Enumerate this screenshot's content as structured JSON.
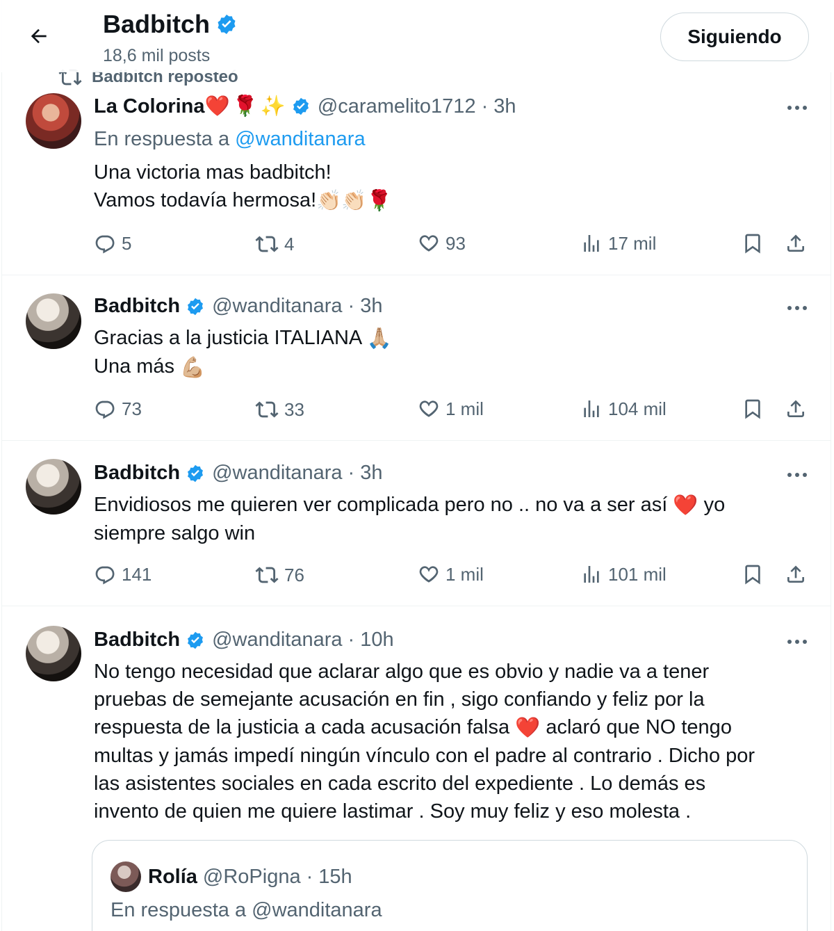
{
  "header": {
    "title": "Badbitch",
    "posts_count": "18,6 mil posts",
    "follow_button": "Siguiendo"
  },
  "repost_banner": "Badbitch reposteó",
  "tweets": [
    {
      "name": "La Colorina",
      "name_emojis": [
        "❤️",
        "🌹",
        "✨"
      ],
      "verified": true,
      "handle": "@caramelito1712",
      "time": "3h",
      "reply_prefix": "En respuesta a",
      "reply_to": "@wanditanara",
      "lines": [
        "Una victoria mas badbitch!",
        "Vamos todavía hermosa!"
      ],
      "line2_emojis": "👏🏻👏🏻🌹",
      "replies": "5",
      "reposts": "4",
      "likes": "93",
      "views": "17 mil"
    },
    {
      "name": "Badbitch",
      "verified": true,
      "handle": "@wanditanara",
      "time": "3h",
      "lines": [
        "Gracias a la justicia ITALIANA",
        "Una más"
      ],
      "line1_emoji": "🙏🏼",
      "line2_emoji": "💪🏼",
      "replies": "73",
      "reposts": "33",
      "likes": "1 mil",
      "views": "104 mil"
    },
    {
      "name": "Badbitch",
      "verified": true,
      "handle": "@wanditanara",
      "time": "3h",
      "lines": [
        "Envidiosos me quieren ver complicada pero no .. no va a ser así",
        "yo",
        "siempre salgo win"
      ],
      "line1_emoji": "❤️",
      "replies": "141",
      "reposts": "76",
      "likes": "1 mil",
      "views": "101 mil"
    },
    {
      "name": "Badbitch",
      "verified": true,
      "handle": "@wanditanara",
      "time": "10h",
      "lines": [
        "No tengo necesidad que aclarar algo que es obvio y nadie va a tener",
        "pruebas de semejante acusación  en fin , sigo confiando y feliz por la",
        "respuesta de la justicia a cada acusación falsa",
        "aclaró que NO tengo",
        "multas y jamás impedí ningún vínculo con el padre al contrario .  Dicho por",
        "las asistentes sociales en cada escrito del expediente . Lo demás es",
        "invento de quien me quiere lastimar . Soy muy feliz y eso molesta ."
      ],
      "line3_emoji": "❤️",
      "quote": {
        "name": "Rolía",
        "handle": "@RoPigna",
        "time": "15h",
        "reply_prefix": "En respuesta a",
        "reply_to": "@wanditanara"
      }
    }
  ],
  "colors": {
    "verified_blue": "#1d9bf0",
    "secondary_text": "#536471",
    "border": "#eff3f4"
  }
}
